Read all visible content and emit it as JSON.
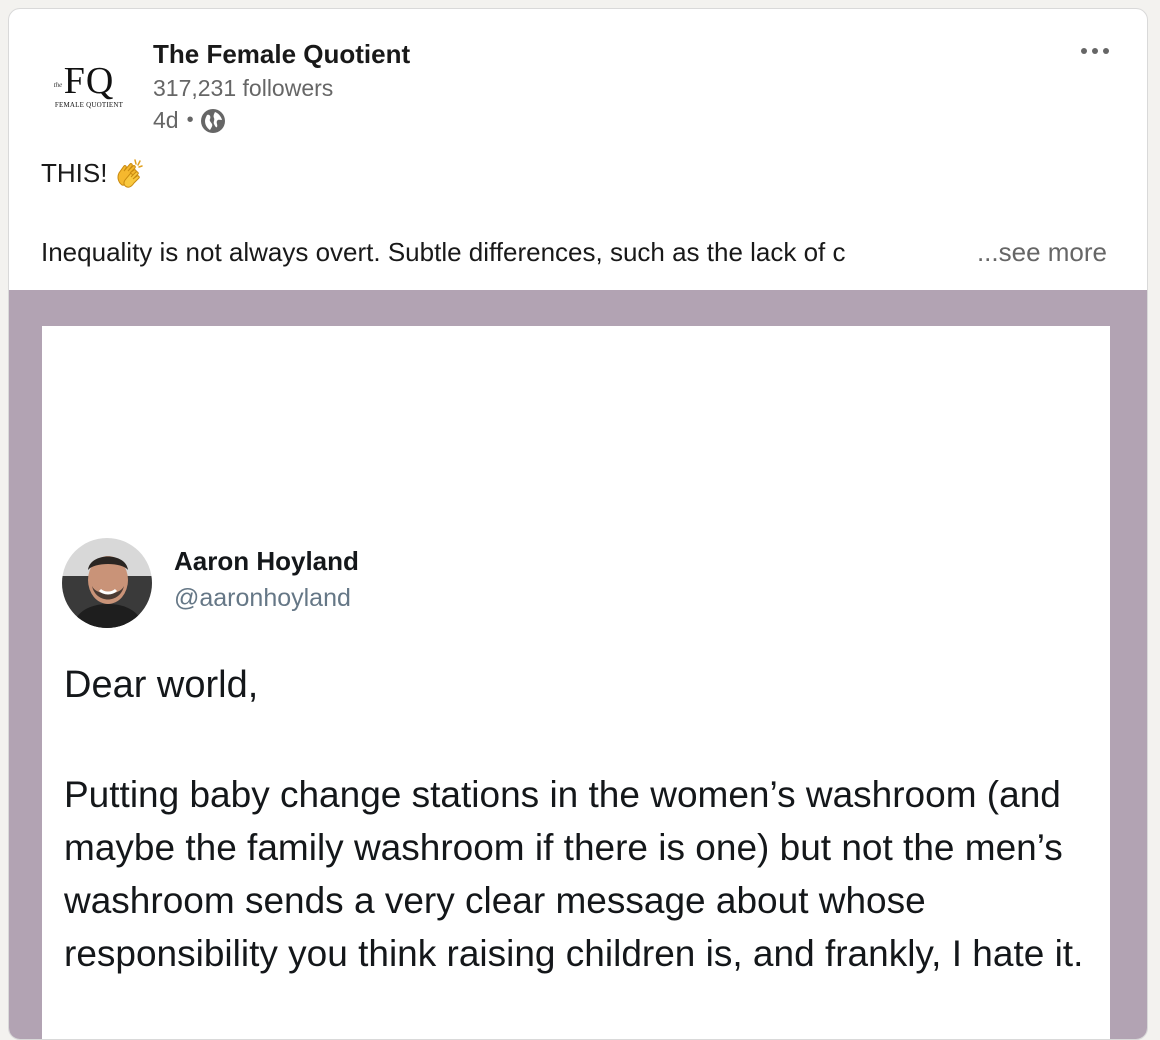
{
  "post": {
    "author": {
      "name": "The Female Quotient",
      "followers": "317,231 followers",
      "time": "4d",
      "separator": "•",
      "visibility_icon": "globe-icon",
      "logo": {
        "mark": "FQ",
        "the": "the",
        "subtitle": "FEMALE QUOTIENT"
      }
    },
    "more_icon": "more-options-icon",
    "text": {
      "line1": "THIS!",
      "emoji": "clapping-hands-icon",
      "line2": "Inequality is not always overt. Subtle differences, such as the lack of c",
      "see_more": "...see more"
    }
  },
  "image": {
    "background_color": "#b2a3b3",
    "tweet": {
      "name": "Aaron Hoyland",
      "handle": "@aaronhoyland",
      "greeting": "Dear world,",
      "body": "Putting baby change stations in the women’s washroom (and maybe the family washroom if there is one) but not the men’s washroom sends a very clear message about whose responsibility you think raising children is, and frankly, I hate it."
    }
  },
  "colors": {
    "primary_text": "#191919",
    "secondary_text": "#666666"
  }
}
